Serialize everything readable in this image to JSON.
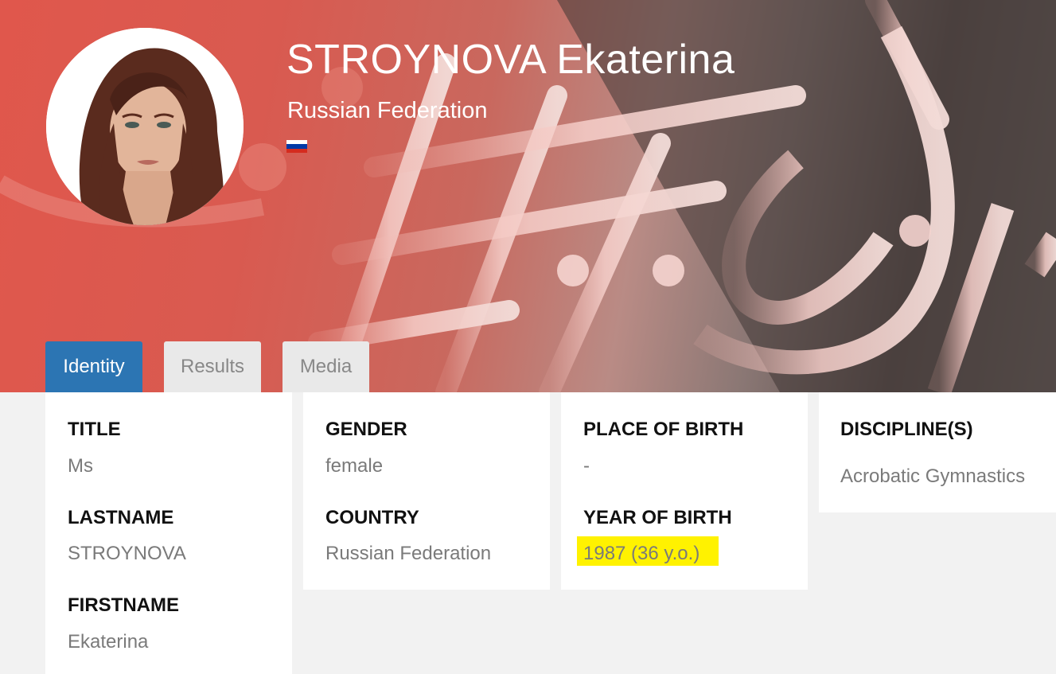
{
  "header": {
    "name": "STROYNOVA Ekaterina",
    "country": "Russian Federation",
    "flag_colors": [
      "#ffffff",
      "#0039a6",
      "#d52b1e"
    ],
    "avatar_icon": "athlete-photo"
  },
  "tabs": [
    {
      "label": "Identity",
      "active": true
    },
    {
      "label": "Results",
      "active": false
    },
    {
      "label": "Media",
      "active": false
    }
  ],
  "identity": {
    "title_label": "TITLE",
    "title_value": "Ms",
    "lastname_label": "LASTNAME",
    "lastname_value": "STROYNOVA",
    "firstname_label": "FIRSTNAME",
    "firstname_value": "Ekaterina",
    "gender_label": "GENDER",
    "gender_value": "female",
    "country_label": "COUNTRY",
    "country_value": "Russian Federation",
    "place_label": "PLACE OF BIRTH",
    "place_value": "-",
    "year_label": "YEAR OF BIRTH",
    "year_value": "1987 (36 y.o.)",
    "discipline_label": "DISCIPLINE(S)",
    "discipline_value": "Acrobatic Gymnastics"
  },
  "colors": {
    "tab_active": "#2c75b3",
    "highlight": "#fff200"
  }
}
